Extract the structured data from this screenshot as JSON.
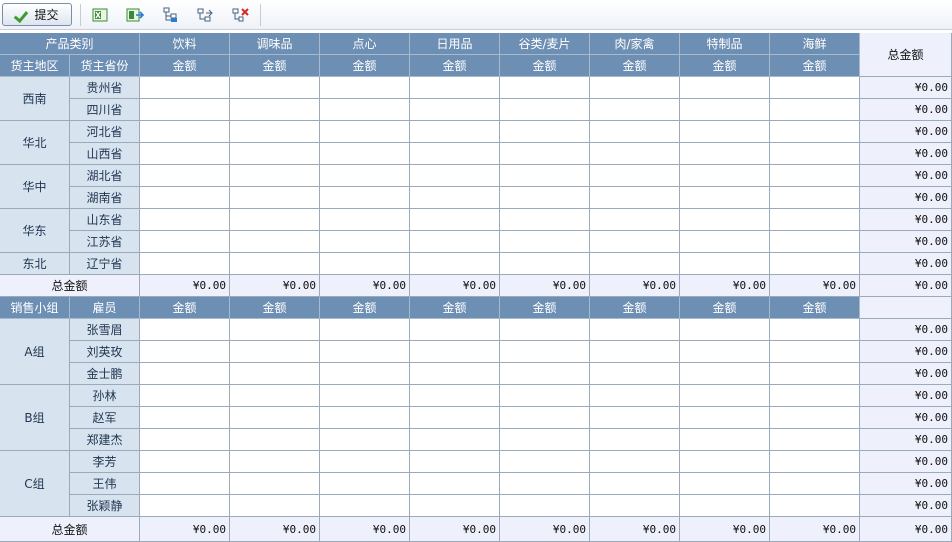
{
  "toolbar": {
    "submit_label": "提交",
    "icons": [
      "excel-export-icon",
      "excel-import-icon",
      "tree-expand-icon",
      "tree-link-icon",
      "delete-icon"
    ]
  },
  "colors": {
    "header_bg": "#6e8fb4",
    "side_bg": "#d8e3f0",
    "total_bg": "#eef0fb"
  },
  "table": {
    "corner_category": "产品类别",
    "total_header": "总金额",
    "categories": [
      "饮料",
      "调味品",
      "点心",
      "日用品",
      "谷类/麦片",
      "肉/家禽",
      "特制品",
      "海鲜"
    ],
    "amount_label": "金额",
    "section1": {
      "col1_header": "货主地区",
      "col2_header": "货主省份",
      "groups": [
        {
          "name": "西南",
          "items": [
            "贵州省",
            "四川省"
          ]
        },
        {
          "name": "华北",
          "items": [
            "河北省",
            "山西省"
          ]
        },
        {
          "name": "华中",
          "items": [
            "湖北省",
            "湖南省"
          ]
        },
        {
          "name": "华东",
          "items": [
            "山东省",
            "江苏省"
          ]
        },
        {
          "name": "东北",
          "items": [
            "辽宁省"
          ]
        }
      ],
      "row_total": "¥0.00",
      "total_label": "总金额",
      "total_values": [
        "¥0.00",
        "¥0.00",
        "¥0.00",
        "¥0.00",
        "¥0.00",
        "¥0.00",
        "¥0.00",
        "¥0.00",
        "¥0.00"
      ]
    },
    "section2": {
      "col1_header": "销售小组",
      "col2_header": "雇员",
      "groups": [
        {
          "name": "A组",
          "items": [
            "张雪眉",
            "刘英玫",
            "金士鹏"
          ]
        },
        {
          "name": "B组",
          "items": [
            "孙林",
            "赵军",
            "郑建杰"
          ]
        },
        {
          "name": "C组",
          "items": [
            "李芳",
            "王伟",
            "张颖静"
          ]
        }
      ],
      "row_total": "¥0.00",
      "total_label": "总金额",
      "total_values": [
        "¥0.00",
        "¥0.00",
        "¥0.00",
        "¥0.00",
        "¥0.00",
        "¥0.00",
        "¥0.00",
        "¥0.00",
        "¥0.00"
      ]
    }
  }
}
